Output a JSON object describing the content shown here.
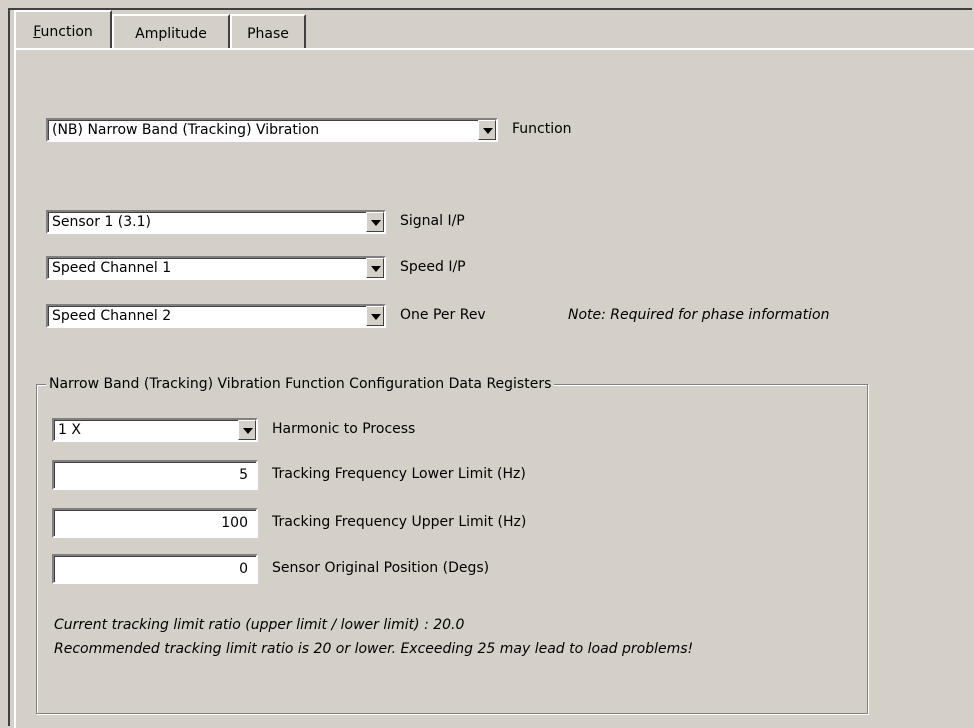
{
  "tabs": [
    {
      "label": "Function",
      "active": true,
      "mnemonic": "F"
    },
    {
      "label": "Amplitude",
      "active": false
    },
    {
      "label": "Phase",
      "active": false
    }
  ],
  "function_select": {
    "value": "(NB)  Narrow Band (Tracking) Vibration",
    "label": "Function"
  },
  "signal_select": {
    "value": "Sensor 1 (3.1)",
    "label": "Signal I/P"
  },
  "speed_select": {
    "value": "Speed Channel 1",
    "label": "Speed I/P"
  },
  "rev_select": {
    "value": "Speed Channel 2",
    "label": "One Per Rev",
    "note": "Note: Required for phase information"
  },
  "group": {
    "title": "Narrow Band (Tracking) Vibration Function Configuration Data Registers",
    "harmonic": {
      "value": "1 X",
      "label": "Harmonic to Process"
    },
    "lower_limit": {
      "value": "5",
      "label": "Tracking Frequency Lower Limit (Hz)"
    },
    "upper_limit": {
      "value": "100",
      "label": "Tracking Frequency Upper Limit (Hz)"
    },
    "sensor_position": {
      "value": "0",
      "label": "Sensor Original Position (Degs)"
    },
    "ratio_text": "Current tracking limit ratio (upper limit / lower limit) : 20.0",
    "recommend_text": "Recommended tracking limit ratio is 20 or lower.  Exceeding 25 may lead to load problems!"
  }
}
